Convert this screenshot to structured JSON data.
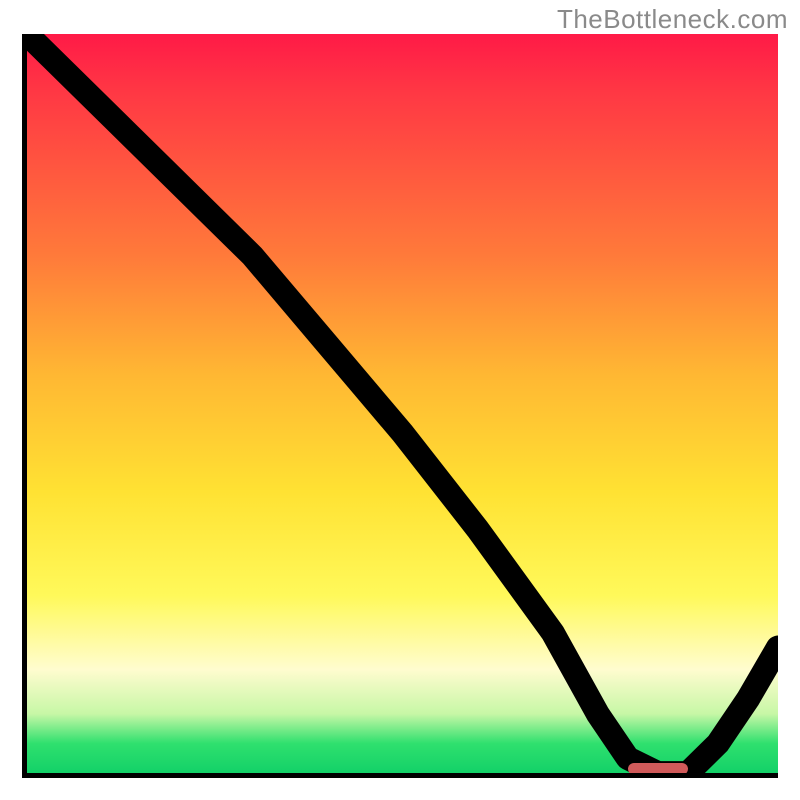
{
  "watermark": "TheBottleneck.com",
  "colors": {
    "axis": "#000000",
    "curve": "#000000",
    "marker": "#d05a5a",
    "gradient_top": "#ff1a47",
    "gradient_mid": "#ffe233",
    "gradient_bottom": "#13d168"
  },
  "chart_data": {
    "type": "line",
    "title": "",
    "xlabel": "",
    "ylabel": "",
    "xlim": [
      0,
      100
    ],
    "ylim": [
      0,
      100
    ],
    "grid": false,
    "legend": false,
    "series": [
      {
        "name": "bottleneck-curve",
        "x": [
          0,
          18,
          24,
          30,
          40,
          50,
          60,
          70,
          76,
          80,
          84,
          88,
          92,
          96,
          100
        ],
        "values": [
          100,
          82,
          76,
          70,
          58,
          46,
          33,
          19,
          8,
          2,
          0,
          0,
          4,
          10,
          17
        ]
      }
    ],
    "marker": {
      "name": "highlight-range",
      "x_start": 80,
      "x_end": 88,
      "y": 0.5
    },
    "annotations": []
  }
}
